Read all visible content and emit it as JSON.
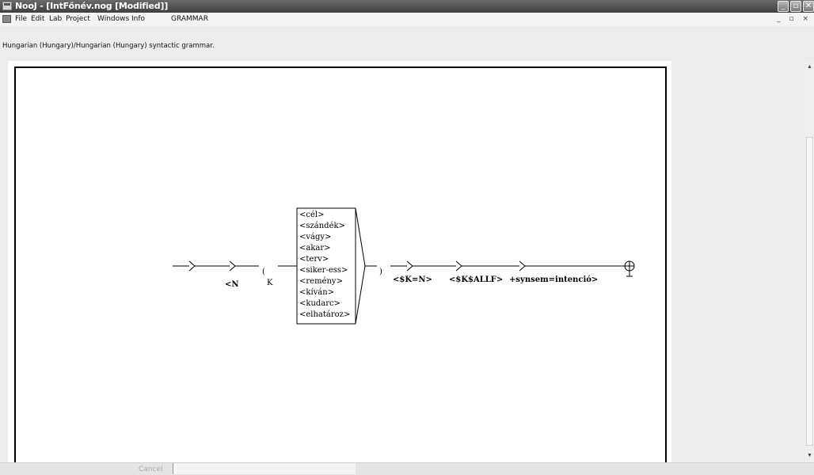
{
  "window": {
    "title": "NooJ - [IntFőnév.nog [Modified]]"
  },
  "menu": {
    "items": [
      "File",
      "Edit",
      "Lab",
      "Project",
      "Windows",
      "Info",
      "GRAMMAR"
    ]
  },
  "info": {
    "text": "Hungarian (Hungary)/Hungarian (Hungary) syntactic grammar."
  },
  "graph": {
    "box_entries": [
      "<cél>",
      "<szándék>",
      "<vágy>",
      "<akar>",
      "<terv>",
      "<siker-ess>",
      "<remény>",
      "<kíván>",
      "<kudarc>",
      "<elhatároz>"
    ],
    "node_n_output": "<N",
    "open_paren": "(",
    "open_paren_label": "K",
    "close_paren": ")",
    "output_1": "<$K=N>",
    "output_2": "<$K$ALLF>",
    "output_3": "+synsem=intenció>"
  },
  "status": {
    "cancel_label": "Cancel"
  }
}
